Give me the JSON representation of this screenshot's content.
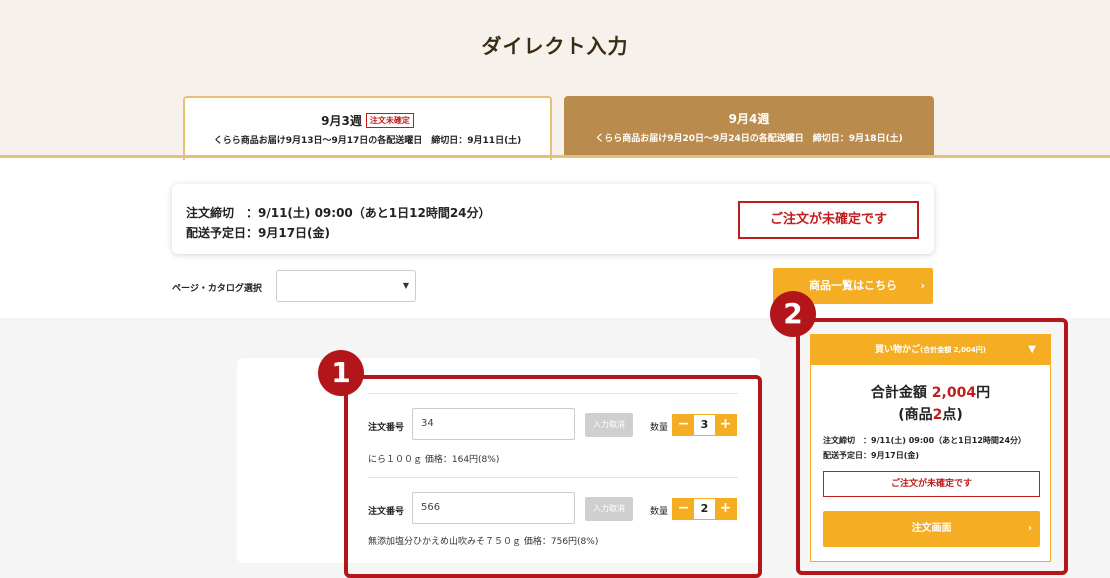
{
  "page": {
    "title": "ダイレクト入力"
  },
  "tabs": [
    {
      "week": "9月3週",
      "badge": "注文未確定",
      "subtitle": "くらら商品お届け9月13日〜9月17日の各配送曜日　締切日：9月11日(土)"
    },
    {
      "week": "9月4週",
      "subtitle": "くらら商品お届け9月20日〜9月24日の各配送曜日　締切日：9月18日(土)"
    }
  ],
  "status": {
    "deadline": "注文締切　：9/11(土) 09:00（あと1日12時間24分）",
    "delivery": "配送予定日：9月17日(金)",
    "warning": "ご注文が未確定です"
  },
  "catalog": {
    "label": "ページ・カタログ選択",
    "value": "",
    "button": "商品一覧はこちら"
  },
  "orders": [
    {
      "label": "注文番号",
      "number": "34",
      "cancel": "入力取消",
      "qty_label": "数量",
      "qty": "3",
      "desc": "にら１００ｇ 価格：164円(8%)"
    },
    {
      "label": "注文番号",
      "number": "566",
      "cancel": "入力取消",
      "qty_label": "数量",
      "qty": "2",
      "desc": "無添加塩分ひかえめ山吹みそ７５０ｇ 価格：756円(8%)"
    }
  ],
  "markers": {
    "one": "1",
    "two": "2"
  },
  "cart": {
    "header": "買い物かご",
    "header_sub": "(合計金額 2,004円)",
    "total_label": "合計金額 ",
    "total_value": "2,004",
    "total_unit": "円",
    "count_open": "(商品",
    "count_value": "2",
    "count_close": "点)",
    "deadline": "注文締切　：9/11(土) 09:00（あと1日12時間24分）",
    "delivery": "配送予定日：9月17日(金)",
    "warning": "ご注文が未確定です",
    "button": "注文画面"
  },
  "colors": {
    "accent": "#f5ae24",
    "tab_inactive": "#b98c4e",
    "warning": "#c01e1e",
    "highlight": "#b2161a"
  },
  "icons": {
    "select_caret": "caret-down-icon",
    "chevron": "chevron-right-icon",
    "cart_toggle": "triangle-down-icon"
  }
}
